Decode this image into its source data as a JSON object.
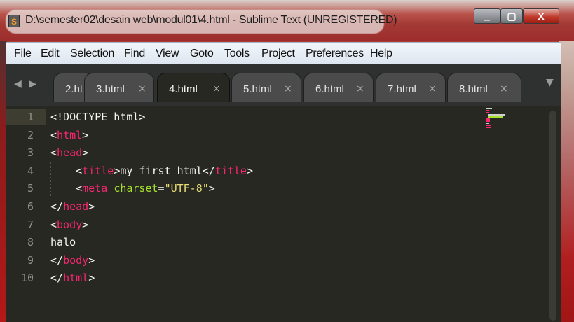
{
  "window": {
    "title": "D:\\semester02\\desain web\\modul01\\4.html - Sublime Text (UNREGISTERED)",
    "app_icon_letter": "S",
    "buttons": {
      "minimize": "_",
      "maximize": "▢",
      "close": "X"
    }
  },
  "menu": [
    "File",
    "Edit",
    "Selection",
    "Find",
    "View",
    "Goto",
    "Tools",
    "Project",
    "Preferences",
    "Help"
  ],
  "tabs": [
    {
      "label": "2.ht",
      "close": ""
    },
    {
      "label": "3.html",
      "close": "×"
    },
    {
      "label": "4.html",
      "close": "×",
      "active": true
    },
    {
      "label": "5.html",
      "close": "×"
    },
    {
      "label": "6.html",
      "close": "×"
    },
    {
      "label": "7.html",
      "close": "×"
    },
    {
      "label": "8.html",
      "close": "×"
    }
  ],
  "tab_nav": "◀ ▶",
  "tab_overflow": "▼",
  "editor": {
    "current_line": 1,
    "lines": [
      {
        "n": "1",
        "parts": [
          [
            "plain",
            "<!DOCTYPE html>"
          ]
        ]
      },
      {
        "n": "2",
        "parts": [
          [
            "plain",
            "<"
          ],
          [
            "tag",
            "html"
          ],
          [
            "plain",
            ">"
          ]
        ]
      },
      {
        "n": "3",
        "parts": [
          [
            "plain",
            "<"
          ],
          [
            "tag",
            "head"
          ],
          [
            "plain",
            ">"
          ]
        ]
      },
      {
        "n": "4",
        "indent": "    ",
        "parts": [
          [
            "plain",
            "<"
          ],
          [
            "tag",
            "title"
          ],
          [
            "plain",
            ">my first html</"
          ],
          [
            "tag",
            "title"
          ],
          [
            "plain",
            ">"
          ]
        ]
      },
      {
        "n": "5",
        "indent": "    ",
        "parts": [
          [
            "plain",
            "<"
          ],
          [
            "tag",
            "meta"
          ],
          [
            "plain",
            " "
          ],
          [
            "attr",
            "charset"
          ],
          [
            "plain",
            "="
          ],
          [
            "str",
            "\"UTF-8\""
          ],
          [
            "plain",
            ">"
          ]
        ]
      },
      {
        "n": "6",
        "parts": [
          [
            "plain",
            "</"
          ],
          [
            "tag",
            "head"
          ],
          [
            "plain",
            ">"
          ]
        ]
      },
      {
        "n": "7",
        "parts": [
          [
            "plain",
            "<"
          ],
          [
            "tag",
            "body"
          ],
          [
            "plain",
            ">"
          ]
        ]
      },
      {
        "n": "8",
        "parts": [
          [
            "plain",
            "halo"
          ]
        ]
      },
      {
        "n": "9",
        "parts": [
          [
            "plain",
            "</"
          ],
          [
            "tag",
            "body"
          ],
          [
            "plain",
            ">"
          ]
        ]
      },
      {
        "n": "10",
        "parts": [
          [
            "plain",
            "</"
          ],
          [
            "tag",
            "html"
          ],
          [
            "plain",
            ">"
          ]
        ]
      }
    ]
  },
  "colors": {
    "editor_bg": "#272822",
    "tag": "#f92672",
    "attr": "#a6e22e",
    "string": "#e6db74",
    "text": "#f8f8f2",
    "line_number": "#8f908a"
  }
}
